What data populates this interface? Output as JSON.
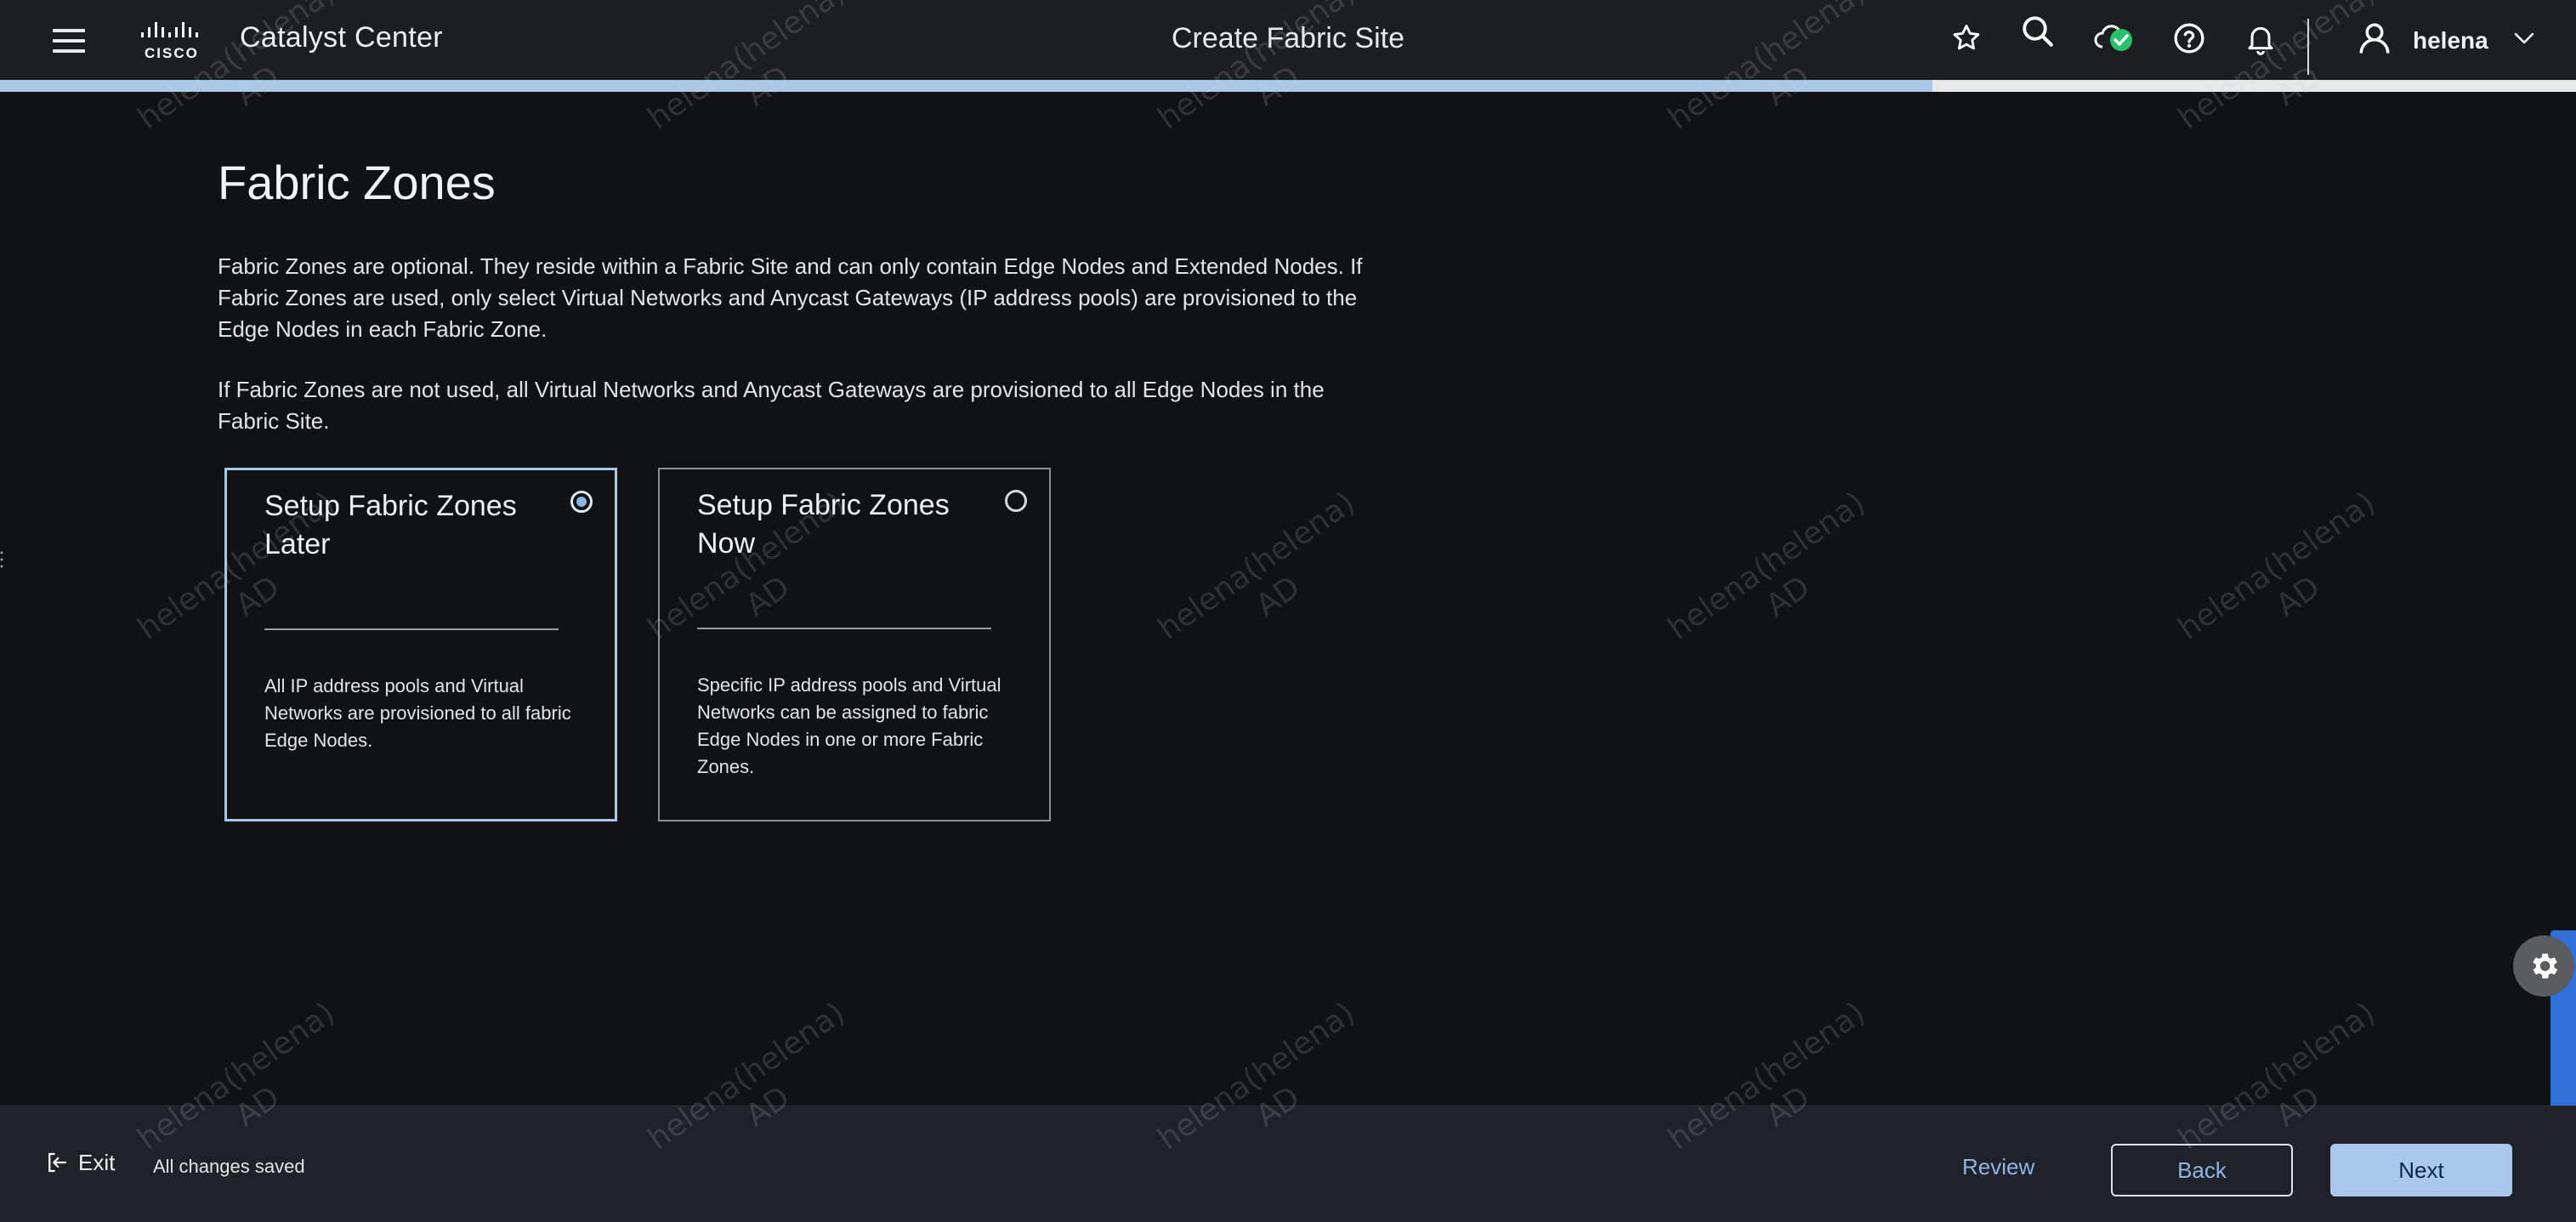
{
  "header": {
    "app_title": "Catalyst Center",
    "page_title": "Create Fabric Site",
    "user_name": "helena",
    "logo_text": "CISCO",
    "progress_percent": 75
  },
  "main": {
    "title": "Fabric Zones",
    "description_1": "Fabric Zones are optional. They reside within a Fabric Site and can only contain Edge Nodes and Extended Nodes. If Fabric Zones are used, only select Virtual Networks and Anycast Gateways (IP address pools) are provisioned to the Edge Nodes in each Fabric Zone.",
    "description_2": "If Fabric Zones are not used, all Virtual Networks and Anycast Gateways are provisioned to all Edge Nodes in the Fabric Site.",
    "options": [
      {
        "title": "Setup Fabric Zones Later",
        "description": "All IP address pools and Virtual Networks are provisioned to all fabric Edge Nodes.",
        "selected": true
      },
      {
        "title": "Setup Fabric Zones Now",
        "description": "Specific IP address pools and Virtual Networks can be assigned to fabric Edge Nodes in one or more Fabric Zones.",
        "selected": false
      }
    ]
  },
  "footer": {
    "exit_label": "Exit",
    "save_status": "All changes saved",
    "review_label": "Review",
    "back_label": "Back",
    "next_label": "Next"
  },
  "watermark": {
    "line1": "helena(helena)",
    "line2": "AD"
  },
  "icons": {
    "menu": "hamburger-menu-icon",
    "favorite": "star-icon",
    "search": "search-icon",
    "status": "cloud-check-icon",
    "help": "help-icon",
    "notifications": "bell-icon",
    "user": "user-icon",
    "dropdown": "chevron-down-icon",
    "exit": "exit-icon",
    "settings": "gear-icon"
  },
  "colors": {
    "background": "#111214",
    "header": "#1d1e20",
    "footer": "#1f2329",
    "accent": "#a9c8ec",
    "link": "#8fb5e6",
    "status_ok": "#27c26b"
  }
}
